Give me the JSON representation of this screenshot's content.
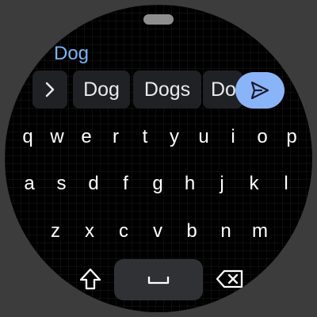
{
  "input": {
    "text": "Dog"
  },
  "suggestions": [
    "Dog",
    "Dogs",
    "Do"
  ],
  "icons": {
    "expand": "chevron-right-icon",
    "send": "send-icon",
    "shift": "shift-icon",
    "space": "space-icon",
    "backspace": "backspace-icon"
  },
  "keyboard": {
    "row1": [
      "q",
      "w",
      "e",
      "r",
      "t",
      "y",
      "u",
      "i",
      "o",
      "p"
    ],
    "row2": [
      "a",
      "s",
      "d",
      "f",
      "g",
      "h",
      "j",
      "k",
      "l"
    ],
    "row3": [
      "z",
      "x",
      "c",
      "v",
      "b",
      "n",
      "m"
    ]
  },
  "colors": {
    "accent": "#8ab4f8",
    "input_text": "#7ab4f5",
    "chip_bg": "#202124",
    "key_text": "#ffffff"
  }
}
